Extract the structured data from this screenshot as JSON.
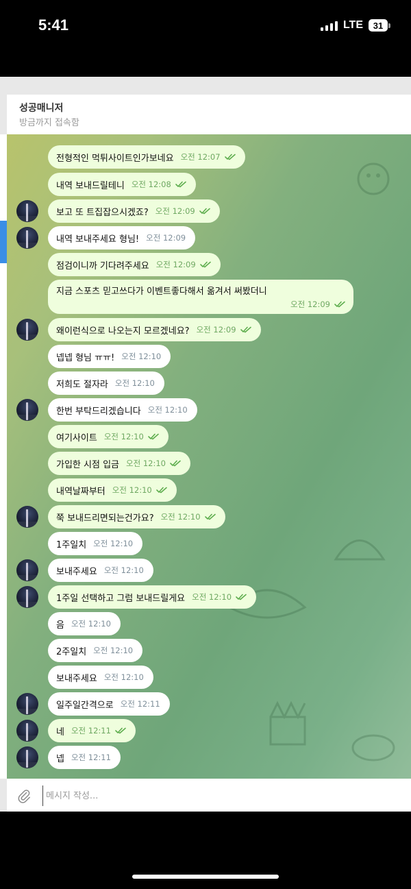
{
  "status_bar": {
    "time": "5:41",
    "network": "LTE",
    "battery": "31"
  },
  "chat": {
    "title": "성공매니저",
    "subtitle": "방금까지 접속함"
  },
  "messages": [
    {
      "text": "전형적인 먹튀사이트인가보네요",
      "time": "오전 12:07",
      "outgoing": true
    },
    {
      "text": "내역 보내드릴테니",
      "time": "오전 12:08",
      "outgoing": true
    },
    {
      "text": "보고 또 트집잡으시겠죠?",
      "time": "오전 12:09",
      "outgoing": true
    },
    {
      "text": "내역 보내주세요 형님!",
      "time": "오전 12:09",
      "outgoing": false
    },
    {
      "text": "점검이니까 기다려주세요",
      "time": "오전 12:09",
      "outgoing": true
    },
    {
      "text": "지금 스포츠 믿고쓰다가 이벤트좋다해서 옮겨서 써봤더니",
      "time": "오전 12:09",
      "outgoing": true
    },
    {
      "text": "왜이런식으로 나오는지 모르겠네요?",
      "time": "오전 12:09",
      "outgoing": true
    },
    {
      "text": "넵넵 형님 ㅠㅠ!",
      "time": "오전 12:10",
      "outgoing": false
    },
    {
      "text": "저희도 절자라",
      "time": "오전 12:10",
      "outgoing": false
    },
    {
      "text": "한번 부탁드리겠습니다",
      "time": "오전 12:10",
      "outgoing": false
    },
    {
      "text": "여기사이트",
      "time": "오전 12:10",
      "outgoing": true
    },
    {
      "text": "가입한 시점 입금",
      "time": "오전 12:10",
      "outgoing": true
    },
    {
      "text": "내역날짜부터",
      "time": "오전 12:10",
      "outgoing": true
    },
    {
      "text": "쭉 보내드리면되는건가요?",
      "time": "오전 12:10",
      "outgoing": true
    },
    {
      "text": "1주일치",
      "time": "오전 12:10",
      "outgoing": false
    },
    {
      "text": "보내주세요",
      "time": "오전 12:10",
      "outgoing": false
    },
    {
      "text": "1주일 선택하고 그럼 보내드릴게요",
      "time": "오전 12:10",
      "outgoing": true
    },
    {
      "text": "음",
      "time": "오전 12:10",
      "outgoing": false
    },
    {
      "text": "2주일치",
      "time": "오전 12:10",
      "outgoing": false
    },
    {
      "text": "보내주세요",
      "time": "오전 12:10",
      "outgoing": false
    },
    {
      "text": "일주일간격으로",
      "time": "오전 12:11",
      "outgoing": false
    },
    {
      "text": "네",
      "time": "오전 12:11",
      "outgoing": true
    },
    {
      "text": "넵",
      "time": "오전 12:11",
      "outgoing": false
    }
  ],
  "input": {
    "placeholder": "메시지 작성..."
  },
  "icons": {
    "attach": "paperclip-icon",
    "read_receipt": "double-check-icon"
  },
  "colors": {
    "incoming_bubble": "#ffffff",
    "outgoing_bubble": "#effedd",
    "check": "#5fae4f",
    "accent": "#3a8ee6"
  }
}
